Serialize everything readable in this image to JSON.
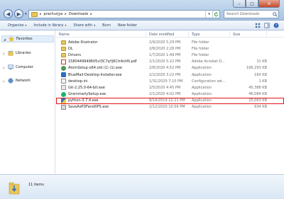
{
  "window": {
    "address": {
      "segment1": "prachurjya",
      "segment2": "Downloads"
    },
    "search_placeholder": "Search Downloads",
    "buttons": {
      "minimize": "–",
      "maximize": "□",
      "close": "✕"
    }
  },
  "toolbar": {
    "organize": "Organize",
    "include_in_library": "Include in library",
    "share_with": "Share with",
    "burn": "Burn",
    "new_folder": "New folder"
  },
  "nav": {
    "favorites": "Favorites",
    "libraries": "Libraries",
    "computer": "Computer",
    "network": "Network"
  },
  "columns": {
    "name": "Name",
    "date": "Date modified",
    "type": "Type",
    "size": "Size"
  },
  "files": [
    {
      "name": "Adobe Illustrator",
      "date": "2/9/2020 5:29 PM",
      "type": "File folder",
      "size": "",
      "icon": "folder"
    },
    {
      "name": "DL",
      "date": "2/8/2020 2:26 PM",
      "type": "File folder",
      "size": "",
      "icon": "folder"
    },
    {
      "name": "Drivers",
      "date": "1/7/2020 1:49 PM",
      "type": "File folder",
      "size": "",
      "icon": "folder"
    },
    {
      "name": "1580449949605vl3C7qYj6CtrAchN.pdf",
      "date": "2/1/2020 5:22 PM",
      "type": "Adobe Acrobat D...",
      "size": "31 KB",
      "icon": "pdf"
    },
    {
      "name": "AtomSetup-x64.old (1) (1).exe",
      "date": "2/8/2020 4:52 PM",
      "type": "Application",
      "size": "166,293 KB",
      "icon": "exe-atom"
    },
    {
      "name": "BlueMail-Desktop-Installer.exe",
      "date": "2/2/2020 3:22 PM",
      "type": "Application",
      "size": "160 KB",
      "icon": "exe-blue"
    },
    {
      "name": "desktop.ini",
      "date": "1/31/2020 7:10 PM",
      "type": "Configuration set...",
      "size": "1 KB",
      "icon": "ini"
    },
    {
      "name": "Git-2.25.0-64-bit.exe",
      "date": "2/5/2020 4:45 PM",
      "type": "Application",
      "size": "45,388 KB",
      "icon": "exe-git"
    },
    {
      "name": "GrammarlySetup.exe",
      "date": "2/1/2020 4:02 PM",
      "type": "Application",
      "size": "46,084 KB",
      "icon": "exe-gram"
    },
    {
      "name": "python-3.7.4.exe",
      "date": "8/14/2019 12:21 PM",
      "type": "Application",
      "size": "25,063 KB",
      "icon": "exe-py",
      "highlighted": true
    },
    {
      "name": "SaveAsPDFandXPS.exe",
      "date": "2/12/2020 10:56 PM",
      "type": "Application",
      "size": "934 KB",
      "icon": "exe-save"
    }
  ],
  "details": {
    "count": "11 items"
  }
}
